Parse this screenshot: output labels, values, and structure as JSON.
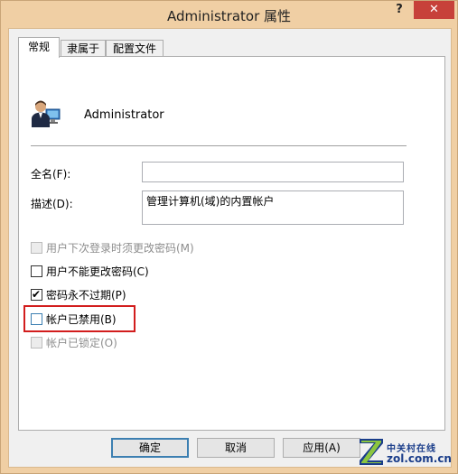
{
  "window": {
    "title": "Administrator 属性",
    "help_label": "?",
    "close_label": "✕"
  },
  "tabs": [
    {
      "label": "常规",
      "active": true
    },
    {
      "label": "隶属于",
      "active": false
    },
    {
      "label": "配置文件",
      "active": false
    }
  ],
  "general": {
    "username": "Administrator",
    "fullname_label": "全名(F):",
    "fullname_value": "",
    "description_label": "描述(D):",
    "description_value": "管理计算机(域)的内置帐户"
  },
  "options": [
    {
      "label": "用户下次登录时须更改密码(M)",
      "checked": false,
      "disabled": true
    },
    {
      "label": "用户不能更改密码(C)",
      "checked": false,
      "disabled": false
    },
    {
      "label": "密码永不过期(P)",
      "checked": true,
      "disabled": false
    },
    {
      "label": "帐户已禁用(B)",
      "checked": false,
      "disabled": false
    },
    {
      "label": "帐户已锁定(O)",
      "checked": false,
      "disabled": true
    }
  ],
  "buttons": {
    "ok": "确定",
    "cancel": "取消",
    "apply": "应用(A)"
  },
  "watermark": {
    "cn": "中关村在线",
    "en": "zol.com.cn"
  },
  "colors": {
    "frame": "#f0cfa4",
    "close": "#c7413a",
    "highlight": "#d21d1d"
  }
}
